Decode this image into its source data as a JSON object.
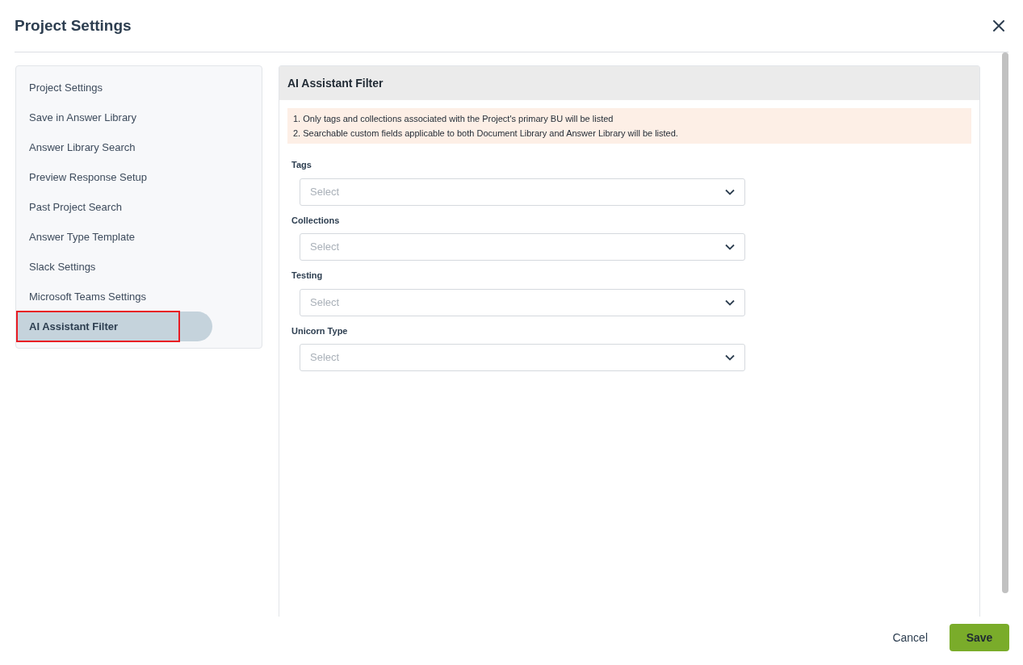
{
  "window": {
    "title": "Project Settings"
  },
  "sidebar": {
    "items": [
      {
        "label": "Project Settings",
        "selected": false
      },
      {
        "label": "Save in Answer Library",
        "selected": false
      },
      {
        "label": "Answer Library Search",
        "selected": false
      },
      {
        "label": "Preview Response Setup",
        "selected": false
      },
      {
        "label": "Past Project Search",
        "selected": false
      },
      {
        "label": "Answer Type Template",
        "selected": false
      },
      {
        "label": "Slack Settings",
        "selected": false
      },
      {
        "label": "Microsoft Teams Settings",
        "selected": false
      },
      {
        "label": "AI Assistant Filter",
        "selected": true
      }
    ]
  },
  "panel": {
    "title": "AI Assistant Filter",
    "notes": [
      "1. Only tags and collections associated with the Project's primary BU will be listed",
      "2. Searchable custom fields applicable to both Document Library and Answer Library will be listed."
    ],
    "fields": [
      {
        "label": "Tags",
        "placeholder": "Select"
      },
      {
        "label": "Collections",
        "placeholder": "Select"
      },
      {
        "label": "Testing",
        "placeholder": "Select"
      },
      {
        "label": "Unicorn Type",
        "placeholder": "Select"
      }
    ]
  },
  "buttons": {
    "cancel": "Cancel",
    "save": "Save"
  }
}
